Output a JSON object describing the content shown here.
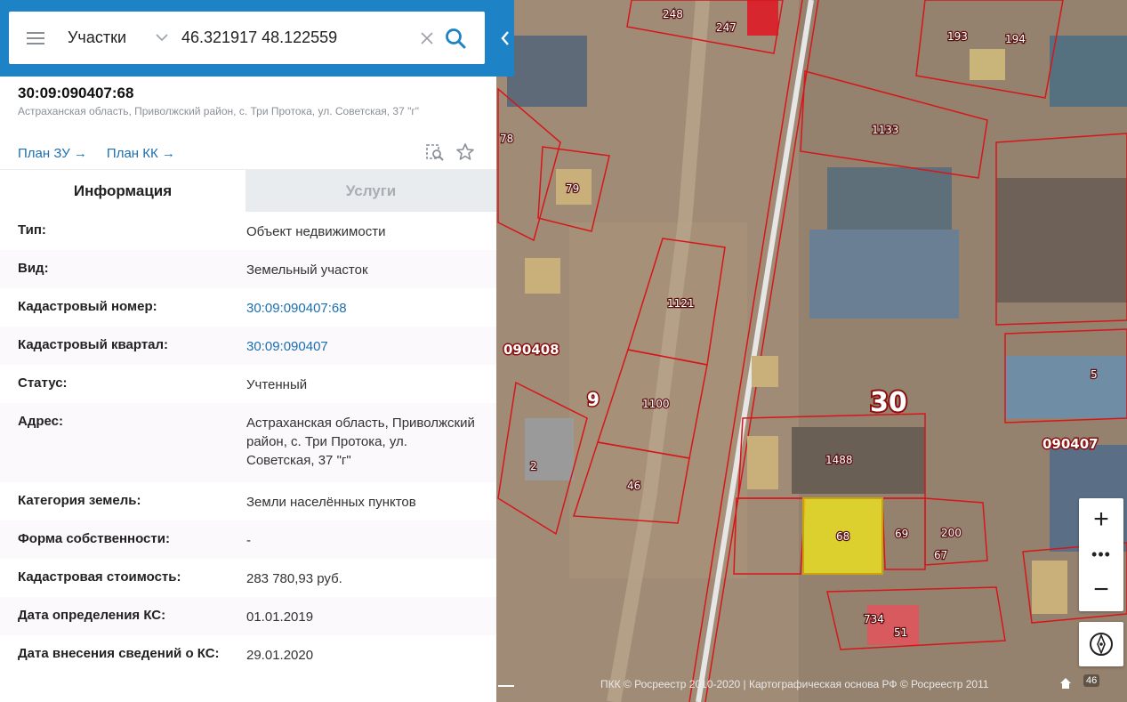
{
  "search": {
    "type_label": "Участки",
    "value": "46.321917 48.122559"
  },
  "object": {
    "cadastral_number": "30:09:090407:68",
    "address_short": "Астраханская область, Приволжский район, с. Три Протока, ул. Советская, 37 \"г\""
  },
  "links": {
    "plan_zu": "План ЗУ",
    "plan_kk": "План КК",
    "arrow": "→"
  },
  "tabs": {
    "info": "Информация",
    "services": "Услуги"
  },
  "info_rows": [
    {
      "label": "Тип:",
      "value": "Объект недвижимости"
    },
    {
      "label": "Вид:",
      "value": "Земельный участок"
    },
    {
      "label": "Кадастровый номер:",
      "value": "30:09:090407:68"
    },
    {
      "label": "Кадастровый квартал:",
      "value": "30:09:090407"
    },
    {
      "label": "Статус:",
      "value": "Учтенный"
    },
    {
      "label": "Адрес:",
      "value": "Астраханская область, Приволжский район, с. Три Протока, ул. Советская, 37 \"г\""
    },
    {
      "label": "Категория земель:",
      "value": "Земли населённых пунктов"
    },
    {
      "label": "Форма собственности:",
      "value": "-"
    },
    {
      "label": "Кадастровая стоимость:",
      "value": "283 780,93 руб."
    },
    {
      "label": "Дата определения КС:",
      "value": "01.01.2019"
    },
    {
      "label": "Дата внесения сведений о КС:",
      "value": "29.01.2020"
    }
  ],
  "map": {
    "parcel_labels": {
      "p248": "248",
      "p247": "247",
      "p193": "193",
      "p194": "194",
      "p78": "78",
      "p79": "79",
      "p1133": "1133",
      "p1121": "1121",
      "p1100": "1100",
      "p46": "46",
      "p2": "2",
      "p1488": "1488",
      "p68": "68",
      "p69": "69",
      "p200": "200",
      "p67": "67",
      "p734": "734",
      "p51": "51",
      "p5": "5",
      "p9": "9"
    },
    "quarter_left": "090408",
    "quarter_right": "090407",
    "district": "30",
    "copyright": "ПКК © Росреестр 2010-2020 | Картографическая основа РФ © Росреестр 2011",
    "zoom_in": "+",
    "zoom_more": "•••",
    "zoom_out": "−",
    "layer_count": "46",
    "colors": {
      "parcel_border": "#d7161b",
      "selected_fill": "#f3ea1a",
      "selected_border": "#c9a20d",
      "accent": "#1d82c6"
    }
  }
}
